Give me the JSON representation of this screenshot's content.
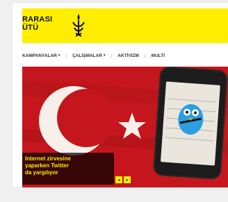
{
  "header": {
    "logo_line1": "RARASI",
    "logo_line2": "ÜTÜ",
    "brand_color": "#ffee00"
  },
  "nav": {
    "items": [
      {
        "label": "KAMPANYALAR",
        "has_dropdown": true
      },
      {
        "label": "ÇALIŞMALAR",
        "has_dropdown": true
      },
      {
        "label": "AKTİVİZM",
        "has_dropdown": false
      },
      {
        "label": "MULTİ",
        "has_dropdown": false
      }
    ],
    "caret": "▾"
  },
  "hero": {
    "caption_line1": "Internet zirvesine",
    "caption_line2": "yaparken Twitter",
    "caption_line3": "da yargılıyor",
    "prev_icon": "◂",
    "next_icon": "▸",
    "flag_color": "#c4161c"
  }
}
